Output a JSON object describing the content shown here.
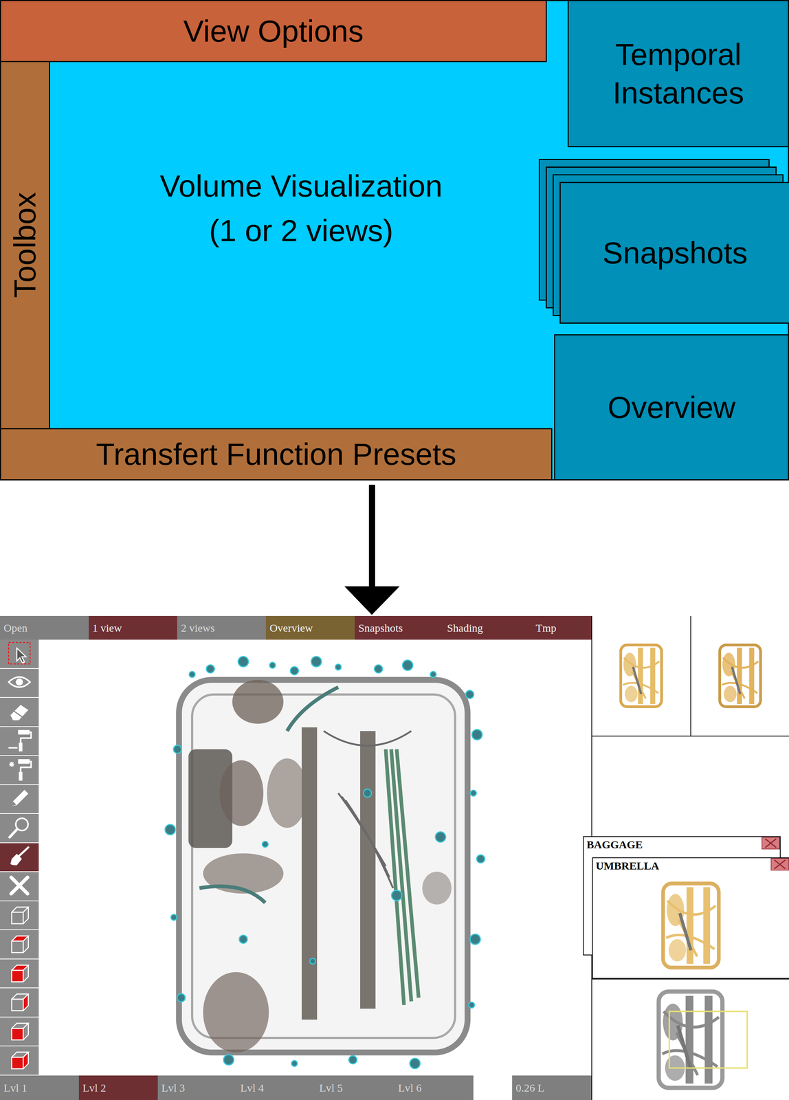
{
  "diagram": {
    "view_options": "View Options",
    "toolbox": "Toolbox",
    "volume_visualization": {
      "title": "Volume Visualization",
      "subtitle": "(1 or 2 views)"
    },
    "transfer_function_presets": "Transfert Function Presets",
    "temporal_instances": "Temporal Instances",
    "snapshots": "Snapshots",
    "overview": "Overview"
  },
  "app": {
    "menu": [
      {
        "label": "Open",
        "selected": false,
        "color": "#7f7f7f"
      },
      {
        "label": "1 view",
        "selected": true,
        "color": "#6e2f33"
      },
      {
        "label": "2 views",
        "selected": false,
        "color": "#7f7f7f"
      },
      {
        "label": "Overview",
        "selected": true,
        "color": "#7a6332"
      },
      {
        "label": "Snapshots",
        "selected": true,
        "color": "#6e2f33"
      },
      {
        "label": "Shading",
        "selected": true,
        "color": "#6e2f33"
      },
      {
        "label": "Tmp",
        "selected": true,
        "color": "#6e2f33"
      }
    ],
    "tools": [
      {
        "selected": false
      },
      {
        "selected": false
      },
      {
        "selected": false
      },
      {
        "selected": false
      },
      {
        "selected": false
      },
      {
        "selected": false
      },
      {
        "selected": false
      },
      {
        "selected": true
      },
      {
        "selected": false
      },
      {
        "selected": false
      },
      {
        "selected": false
      },
      {
        "selected": false
      },
      {
        "selected": false
      },
      {
        "selected": false
      },
      {
        "selected": false
      }
    ],
    "levels": [
      {
        "label": "Lvl 1",
        "selected": false
      },
      {
        "label": "Lvl 2",
        "selected": true
      },
      {
        "label": "Lvl 3",
        "selected": false
      },
      {
        "label": "Lvl 4",
        "selected": false
      },
      {
        "label": "Lvl 5",
        "selected": false
      },
      {
        "label": "Lvl 6",
        "selected": false
      }
    ],
    "volume": "0.26 L",
    "snapshots": [
      {
        "title": "BAGGAGE"
      },
      {
        "title": "UMBRELLA"
      }
    ]
  }
}
